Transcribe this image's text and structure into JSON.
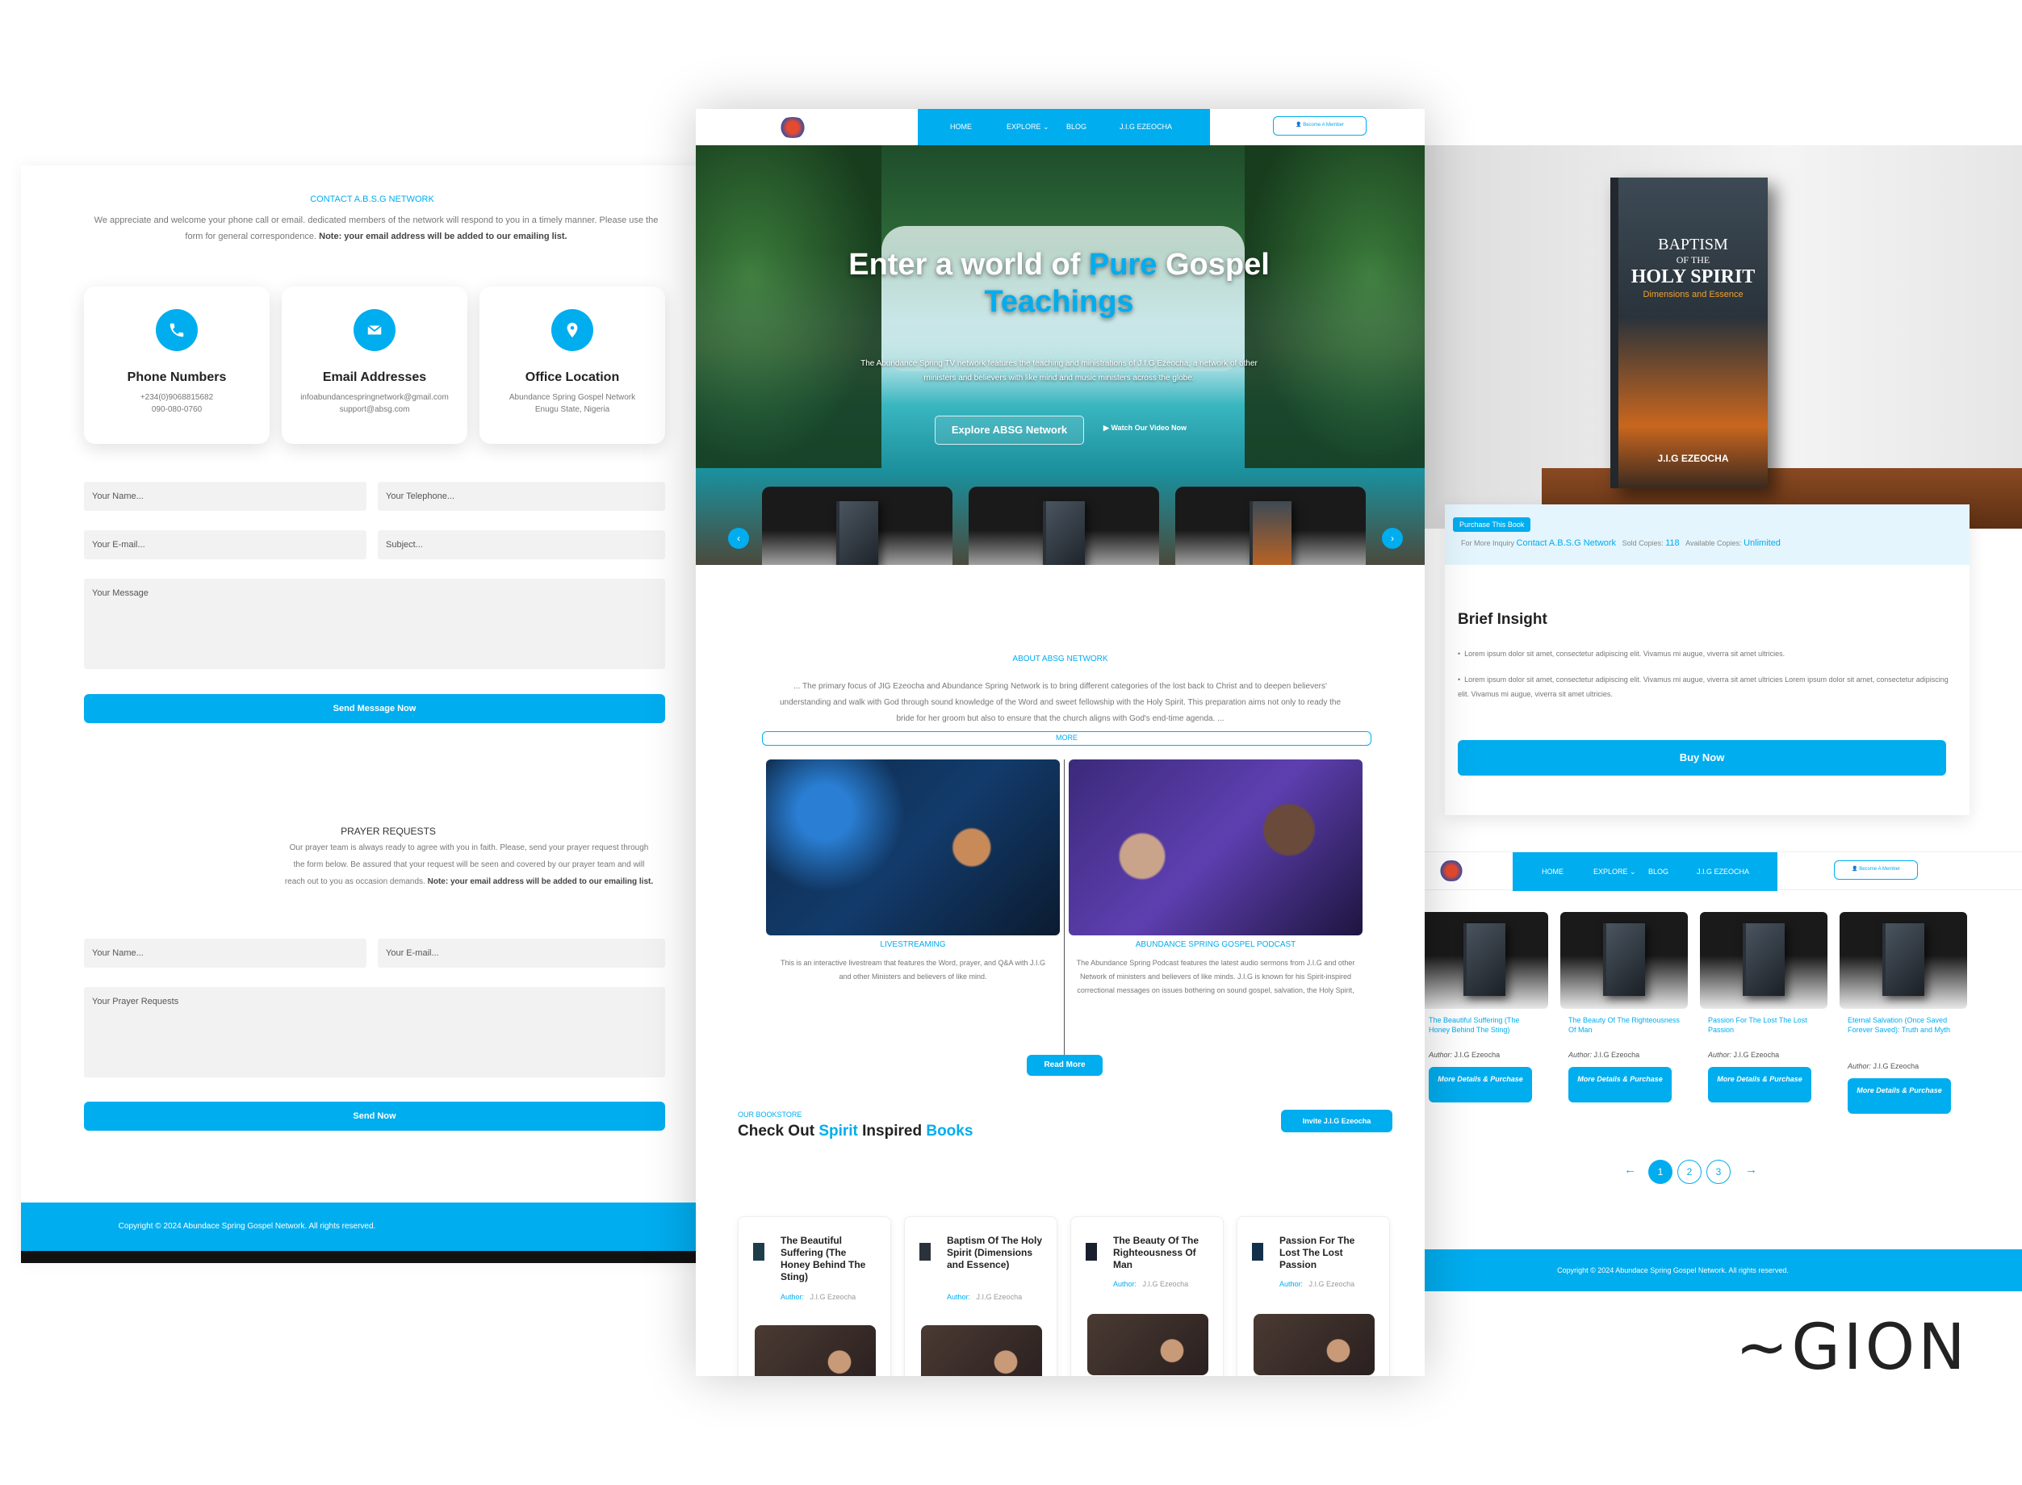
{
  "contact": {
    "section_title": "CONTACT A.B.S.G NETWORK",
    "intro": "We appreciate and welcome your phone call or email. dedicated members of the network will respond to you in a timely manner. Please use the form for general correspondence.",
    "intro_note": "Note: your email address will be added to our emailing list.",
    "cards": [
      {
        "title": "Phone Numbers",
        "line1": "+234(0)9068815682",
        "line2": "090-080-0760",
        "icon": "phone-icon"
      },
      {
        "title": "Email Addresses",
        "line1": "infoabundancespringnetwork@gmail.com",
        "line2": "support@absg.com",
        "icon": "envelope-icon"
      },
      {
        "title": "Office Location",
        "line1": "Abundance Spring Gospel Network",
        "line2": "Enugu State, Nigeria",
        "icon": "map-icon"
      }
    ],
    "form": {
      "name_ph": "Your Name...",
      "phone_ph": "Your Telephone...",
      "email_ph": "Your E-mail...",
      "subject_ph": "Subject...",
      "message_ph": "Your Message",
      "submit": "Send Message Now"
    }
  },
  "prayer": {
    "title": "PRAYER REQUESTS",
    "text": "Our prayer team is always ready to agree with you in faith. Please, send your prayer request through the form below. Be assured that your request will be seen and covered by our prayer team and will reach out to you as occasion demands.",
    "note": "Note: your email address will be added to our emailing list.",
    "name_ph": "Your Name...",
    "email_ph": "Your E-mail...",
    "requests_ph": "Your Prayer Requests",
    "submit": "Send Now"
  },
  "footer": {
    "copyright": "Copyright © 2024 Abundace Spring Gospel Network. All rights reserved."
  },
  "nav": {
    "home": "HOME",
    "explore": "EXPLORE",
    "blog": "BLOG",
    "author": "J.I.G EZEOCHA",
    "member": "Become A Member",
    "accent": "#00adef"
  },
  "hero": {
    "title_a": "Enter a world of ",
    "title_b": "Pure",
    "title_c": " Gospel",
    "title_d": "Teachings",
    "text": "The Abundance Spring TV network features the teaching and ministrations of J.I.G Ezeocha, a network of other ministers and believers with like mind and music ministers across the globe.",
    "explore_btn": "Explore ABSG Network",
    "video_btn": "Watch Our Video Now"
  },
  "about": {
    "label": "ABOUT ABSG NETWORK",
    "text": "... The primary focus of JIG Ezeocha and Abundance Spring Network is to bring different categories of the lost back to Christ and to deepen believers' understanding and walk with God through sound knowledge of the Word and sweet fellowship with the Holy Spirit. This preparation aims not only to ready the bride for her groom but also to ensure that the church aligns with God's end-time agenda. ...",
    "more": "MORE",
    "live_title": "LIVESTREAMING",
    "live_text": "This is an interactive livestream that features the Word, prayer, and Q&A with J.I.G and other Ministers and believers of like mind.",
    "podcast_title": "ABUNDANCE SPRING GOSPEL PODCAST",
    "podcast_text": "The Abundance Spring Podcast features the latest audio sermons from J.I.G and other Network of ministers and believers of like minds. J.I.G is known for his Spirit-inspired correctional messages on issues bothering on sound gospel, salvation, the Holy Spirit, Prayer, Christian suffering, Spiritual Warfare, Faith etc",
    "read_more": "Read More"
  },
  "bookstore": {
    "label": "OUR BOOKSTORE",
    "heading_a": "Check Out ",
    "heading_b": "Spirit",
    "heading_c": " Inspired ",
    "heading_d": "Books",
    "invite": "Invite J.I.G Ezeocha",
    "author_label": "Author:",
    "author": "J.I.G Ezeocha",
    "details_btn": "More Details & Purchase",
    "books": [
      "The Beautiful Suffering (The Honey Behind The Sting)",
      "Baptism Of The Holy Spirit (Dimensions and Essence)",
      "The Beauty Of The Righteousness Of Man",
      "Passion For The Lost The Lost Passion"
    ]
  },
  "book_detail": {
    "cover_title1": "BAPTISM",
    "cover_title2": "OF THE",
    "cover_title3": "HOLY SPIRIT",
    "cover_subtitle": "Dimensions and Essence",
    "cover_author": "J.I.G EZEOCHA",
    "purchase_tag": "Purchase This Book",
    "inquiry_label": "For More Inquiry",
    "inquiry_link": "Contact A.B.S.G Network",
    "sold_label": "Sold Copies:",
    "sold_value": "118",
    "available_label": "Available Copies:",
    "available_value": "Unlimited",
    "insight_title": "Brief Insight",
    "bullet1": "Lorem ipsum dolor sit amet, consectetur adipiscing elit. Vivamus mi augue, viverra sit amet ultricies.",
    "bullet2": "Lorem ipsum dolor sit amet, consectetur adipiscing elit. Vivamus mi augue, viverra sit amet ultricies Lorem ipsum dolor sit amet, consectetur adipiscing elit. Vivamus mi augue, viverra sit amet ultricies.",
    "buy": "Buy Now"
  },
  "listing": {
    "books": [
      "The Beautiful Suffering (The Honey Behind The Sting)",
      "The Beauty Of The Righteousness Of Man",
      "Passion For The Lost The Lost Passion",
      "Eternal Salvation (Once Saved Forever Saved): Truth and Myth"
    ],
    "author_label": "Author:",
    "author": "J.I.G Ezeocha",
    "details_btn": "More Details & Purchase",
    "pages": [
      "1",
      "2",
      "3"
    ]
  },
  "signature": "~GION"
}
